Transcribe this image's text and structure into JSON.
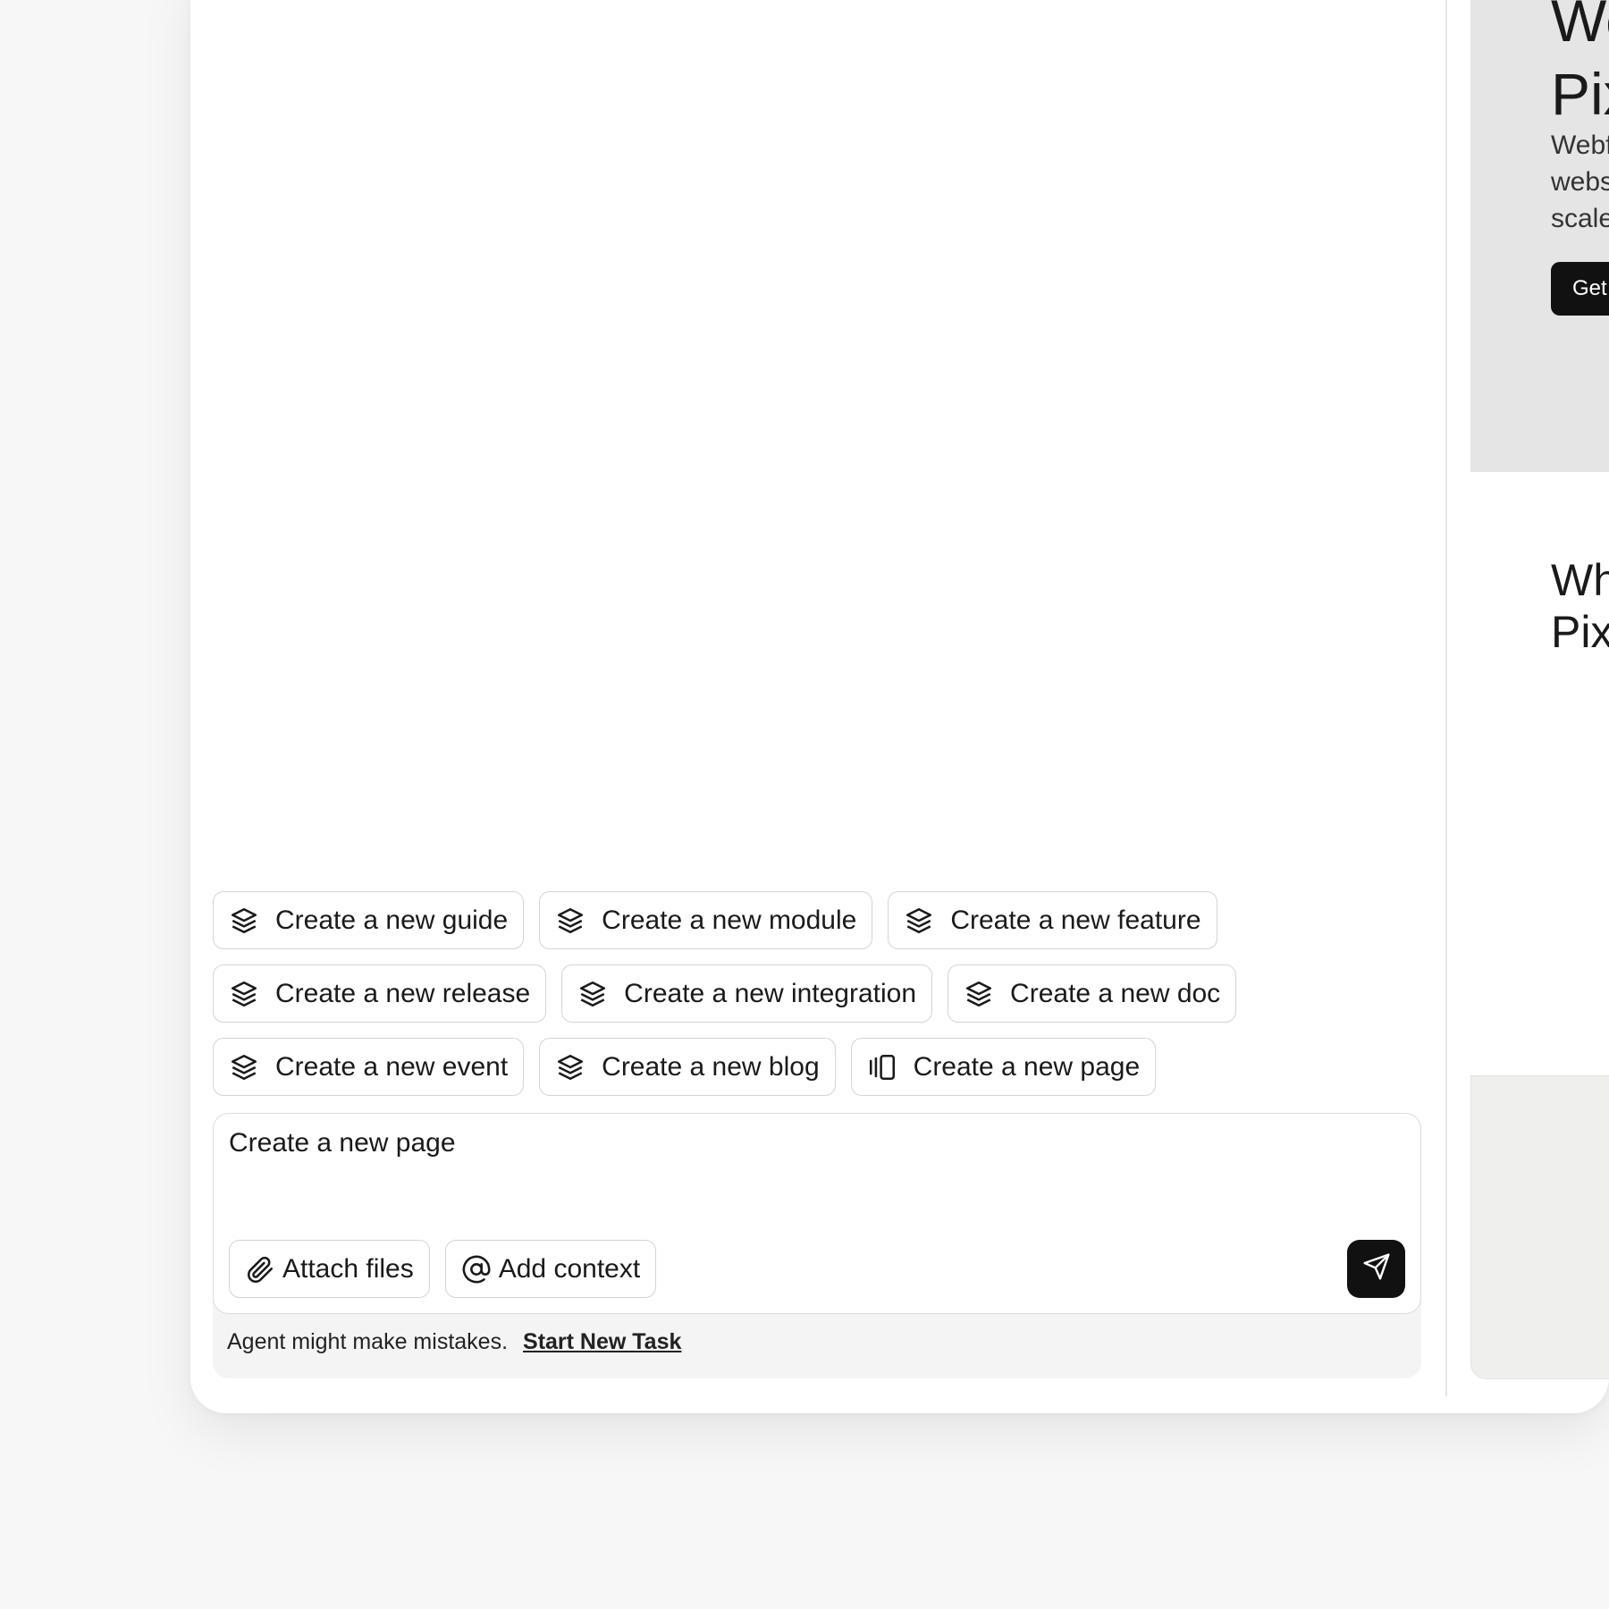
{
  "suggestions": {
    "rows": [
      [
        "Create a new guide",
        "Create a new module",
        "Create a new feature"
      ],
      [
        "Create a new release",
        "Create a new integration",
        "Create a new doc"
      ],
      [
        "Create a new event",
        "Create a new blog",
        "Create a new page"
      ]
    ],
    "icons": [
      "layers-icon",
      "page-layout-icon"
    ]
  },
  "composer": {
    "input_value": "Create a new page",
    "attach_label": "Attach files",
    "context_label": "Add context",
    "send_icon": "send-icon"
  },
  "footer": {
    "disclaimer": "Agent might make mistakes.",
    "new_task_link": "Start New Task"
  },
  "preview": {
    "hero_title_line1": "We",
    "hero_title_line2": "Pix",
    "hero_desc_line1": "Webf",
    "hero_desc_line2": "webs",
    "hero_desc_line3": "scale",
    "hero_cta": "Get",
    "section_title_line1": "Wh",
    "section_title_line2": "Pix"
  },
  "colors": {
    "background": "#f7f7f7",
    "panel": "#ffffff",
    "accent_dark": "#111111",
    "preview_hero": "#e5e5e5",
    "preview_grey": "#efefed"
  }
}
